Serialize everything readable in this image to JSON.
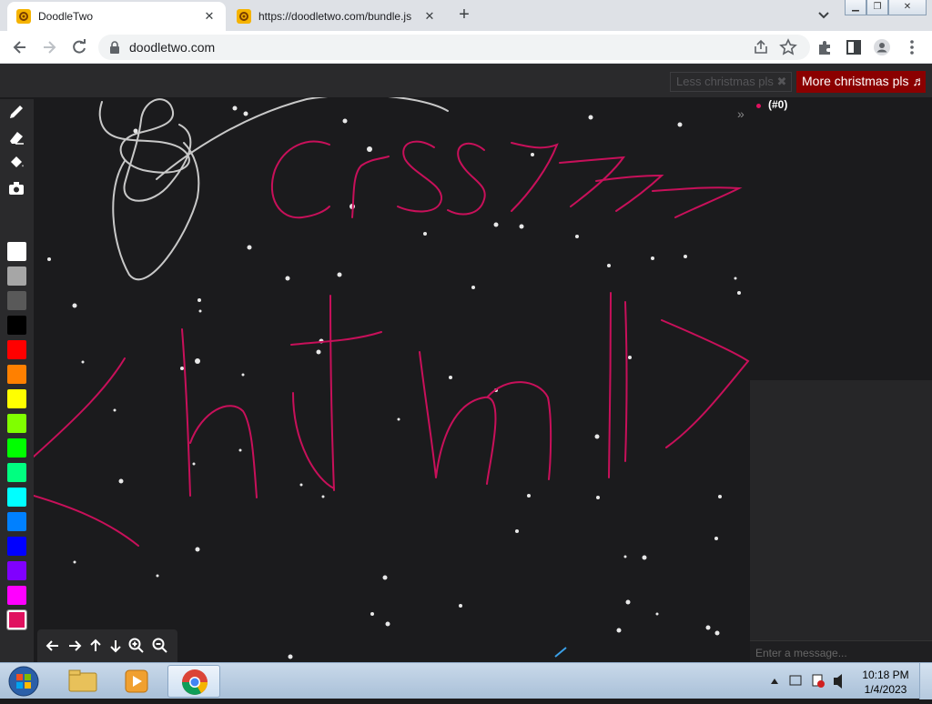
{
  "browser": {
    "tabs": [
      {
        "title": "DoodleTwo",
        "active": true
      },
      {
        "title": "https://doodletwo.com/bundle.js",
        "active": false
      }
    ],
    "address": "doodletwo.com"
  },
  "app": {
    "less_christmas_label": "Less christmas pls ✖",
    "more_christmas_label": "More christmas pls ♬",
    "chat_toggle": "»",
    "user_label": "(#0)",
    "chat_placeholder": "Enter a message...",
    "palette": [
      "#ffffff",
      "#a6a6a6",
      "#595959",
      "#000000",
      "#ff0000",
      "#ff8000",
      "#ffff00",
      "#80ff00",
      "#00ff00",
      "#00ff80",
      "#00ffff",
      "#0080ff",
      "#0000ff",
      "#8000ff",
      "#ff00ff",
      "#ff0080"
    ],
    "selected_color": "#e0115f",
    "stroke_color": "#c8105a"
  },
  "taskbar": {
    "time": "10:18 PM",
    "date": "1/4/2023"
  }
}
